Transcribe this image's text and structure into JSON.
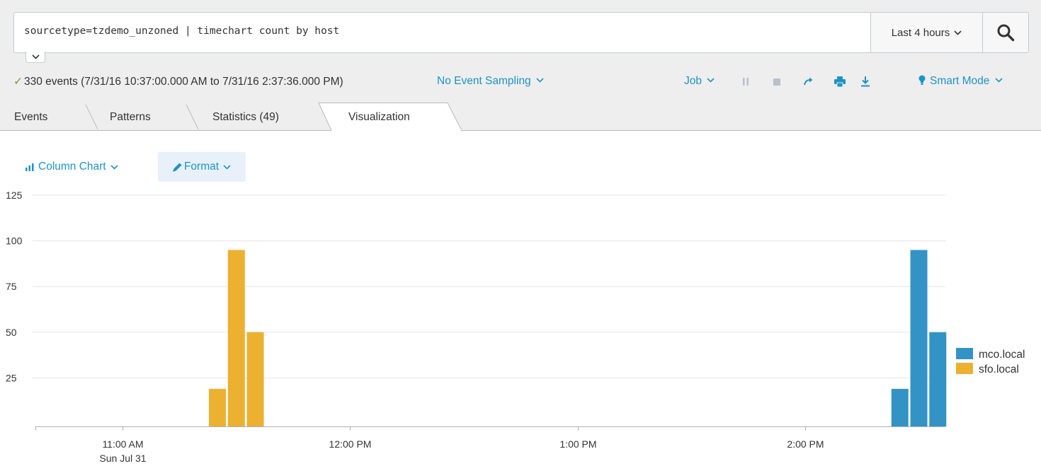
{
  "search": {
    "query": "sourcetype=tzdemo_unzoned | timechart count by host",
    "time_range": "Last 4 hours"
  },
  "status": {
    "events_summary": "330 events (7/31/16 10:37:00.000 AM to 7/31/16 2:37:36.000 PM)",
    "sampling": "No Event Sampling",
    "job": "Job",
    "mode": "Smart Mode"
  },
  "tabs": [
    {
      "label": "Events",
      "active": false
    },
    {
      "label": "Patterns",
      "active": false
    },
    {
      "label": "Statistics (49)",
      "active": false
    },
    {
      "label": "Visualization",
      "active": true
    }
  ],
  "viz_controls": {
    "chart_type": "Column Chart",
    "format": "Format"
  },
  "colors": {
    "accent": "#1e93c6",
    "success": "#65a637",
    "mco": "#3393c5",
    "sfo": "#ecb130"
  },
  "icons": {
    "search": "magnifier-icon",
    "pause": "pause-icon",
    "stop": "stop-icon",
    "share": "share-icon",
    "print": "print-icon",
    "export": "download-icon",
    "mode": "lightbulb-icon",
    "chart": "bar-chart-icon",
    "format": "pencil-icon"
  },
  "chart_data": {
    "type": "bar",
    "stacked": false,
    "x_tick_labels": [
      {
        "time": "11:00 AM",
        "date": "Sun Jul 31"
      },
      {
        "time": "12:00 PM",
        "date": ""
      },
      {
        "time": "1:00 PM",
        "date": ""
      },
      {
        "time": "2:00 PM",
        "date": ""
      }
    ],
    "y_ticks": [
      25,
      50,
      75,
      100,
      125
    ],
    "ylim": [
      0,
      125
    ],
    "x_range": [
      "10:37 AM",
      "2:37 PM"
    ],
    "grid": true,
    "legend_position": "right",
    "series": [
      {
        "name": "mco.local",
        "color": "#3393c5",
        "points": [
          {
            "time": "2:25 PM",
            "value": 19
          },
          {
            "time": "2:30 PM",
            "value": 95
          },
          {
            "time": "2:35 PM",
            "value": 50
          }
        ]
      },
      {
        "name": "sfo.local",
        "color": "#ecb130",
        "points": [
          {
            "time": "11:25 AM",
            "value": 19
          },
          {
            "time": "11:30 AM",
            "value": 95
          },
          {
            "time": "11:35 AM",
            "value": 50
          }
        ]
      }
    ]
  }
}
